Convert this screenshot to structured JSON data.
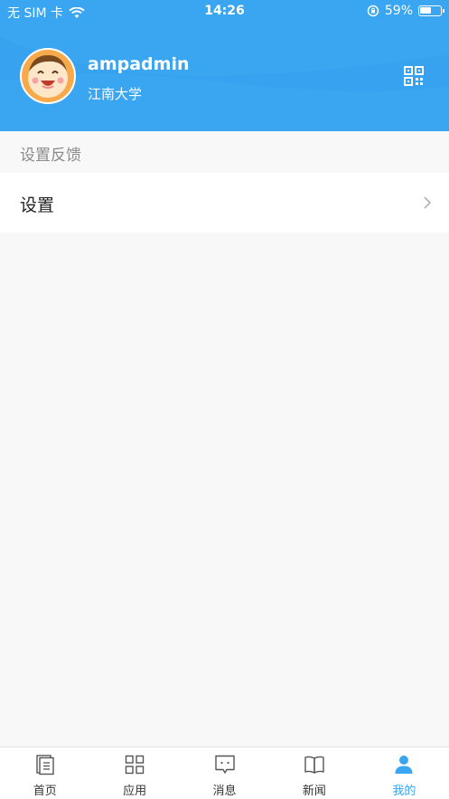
{
  "status_bar": {
    "carrier": "无 SIM 卡",
    "time": "14:26",
    "battery": "59%",
    "battery_level": 0.59
  },
  "profile": {
    "username": "ampadmin",
    "school": "江南大学"
  },
  "section": {
    "title": "设置反馈"
  },
  "settings": {
    "label": "设置"
  },
  "tabs": [
    {
      "label": "首页",
      "icon": "home-doc-icon"
    },
    {
      "label": "应用",
      "icon": "grid-icon"
    },
    {
      "label": "消息",
      "icon": "message-icon"
    },
    {
      "label": "新闻",
      "icon": "book-icon"
    },
    {
      "label": "我的",
      "icon": "person-icon"
    }
  ],
  "colors": {
    "accent": "#3aa5f0",
    "background": "#f8f8f8"
  }
}
